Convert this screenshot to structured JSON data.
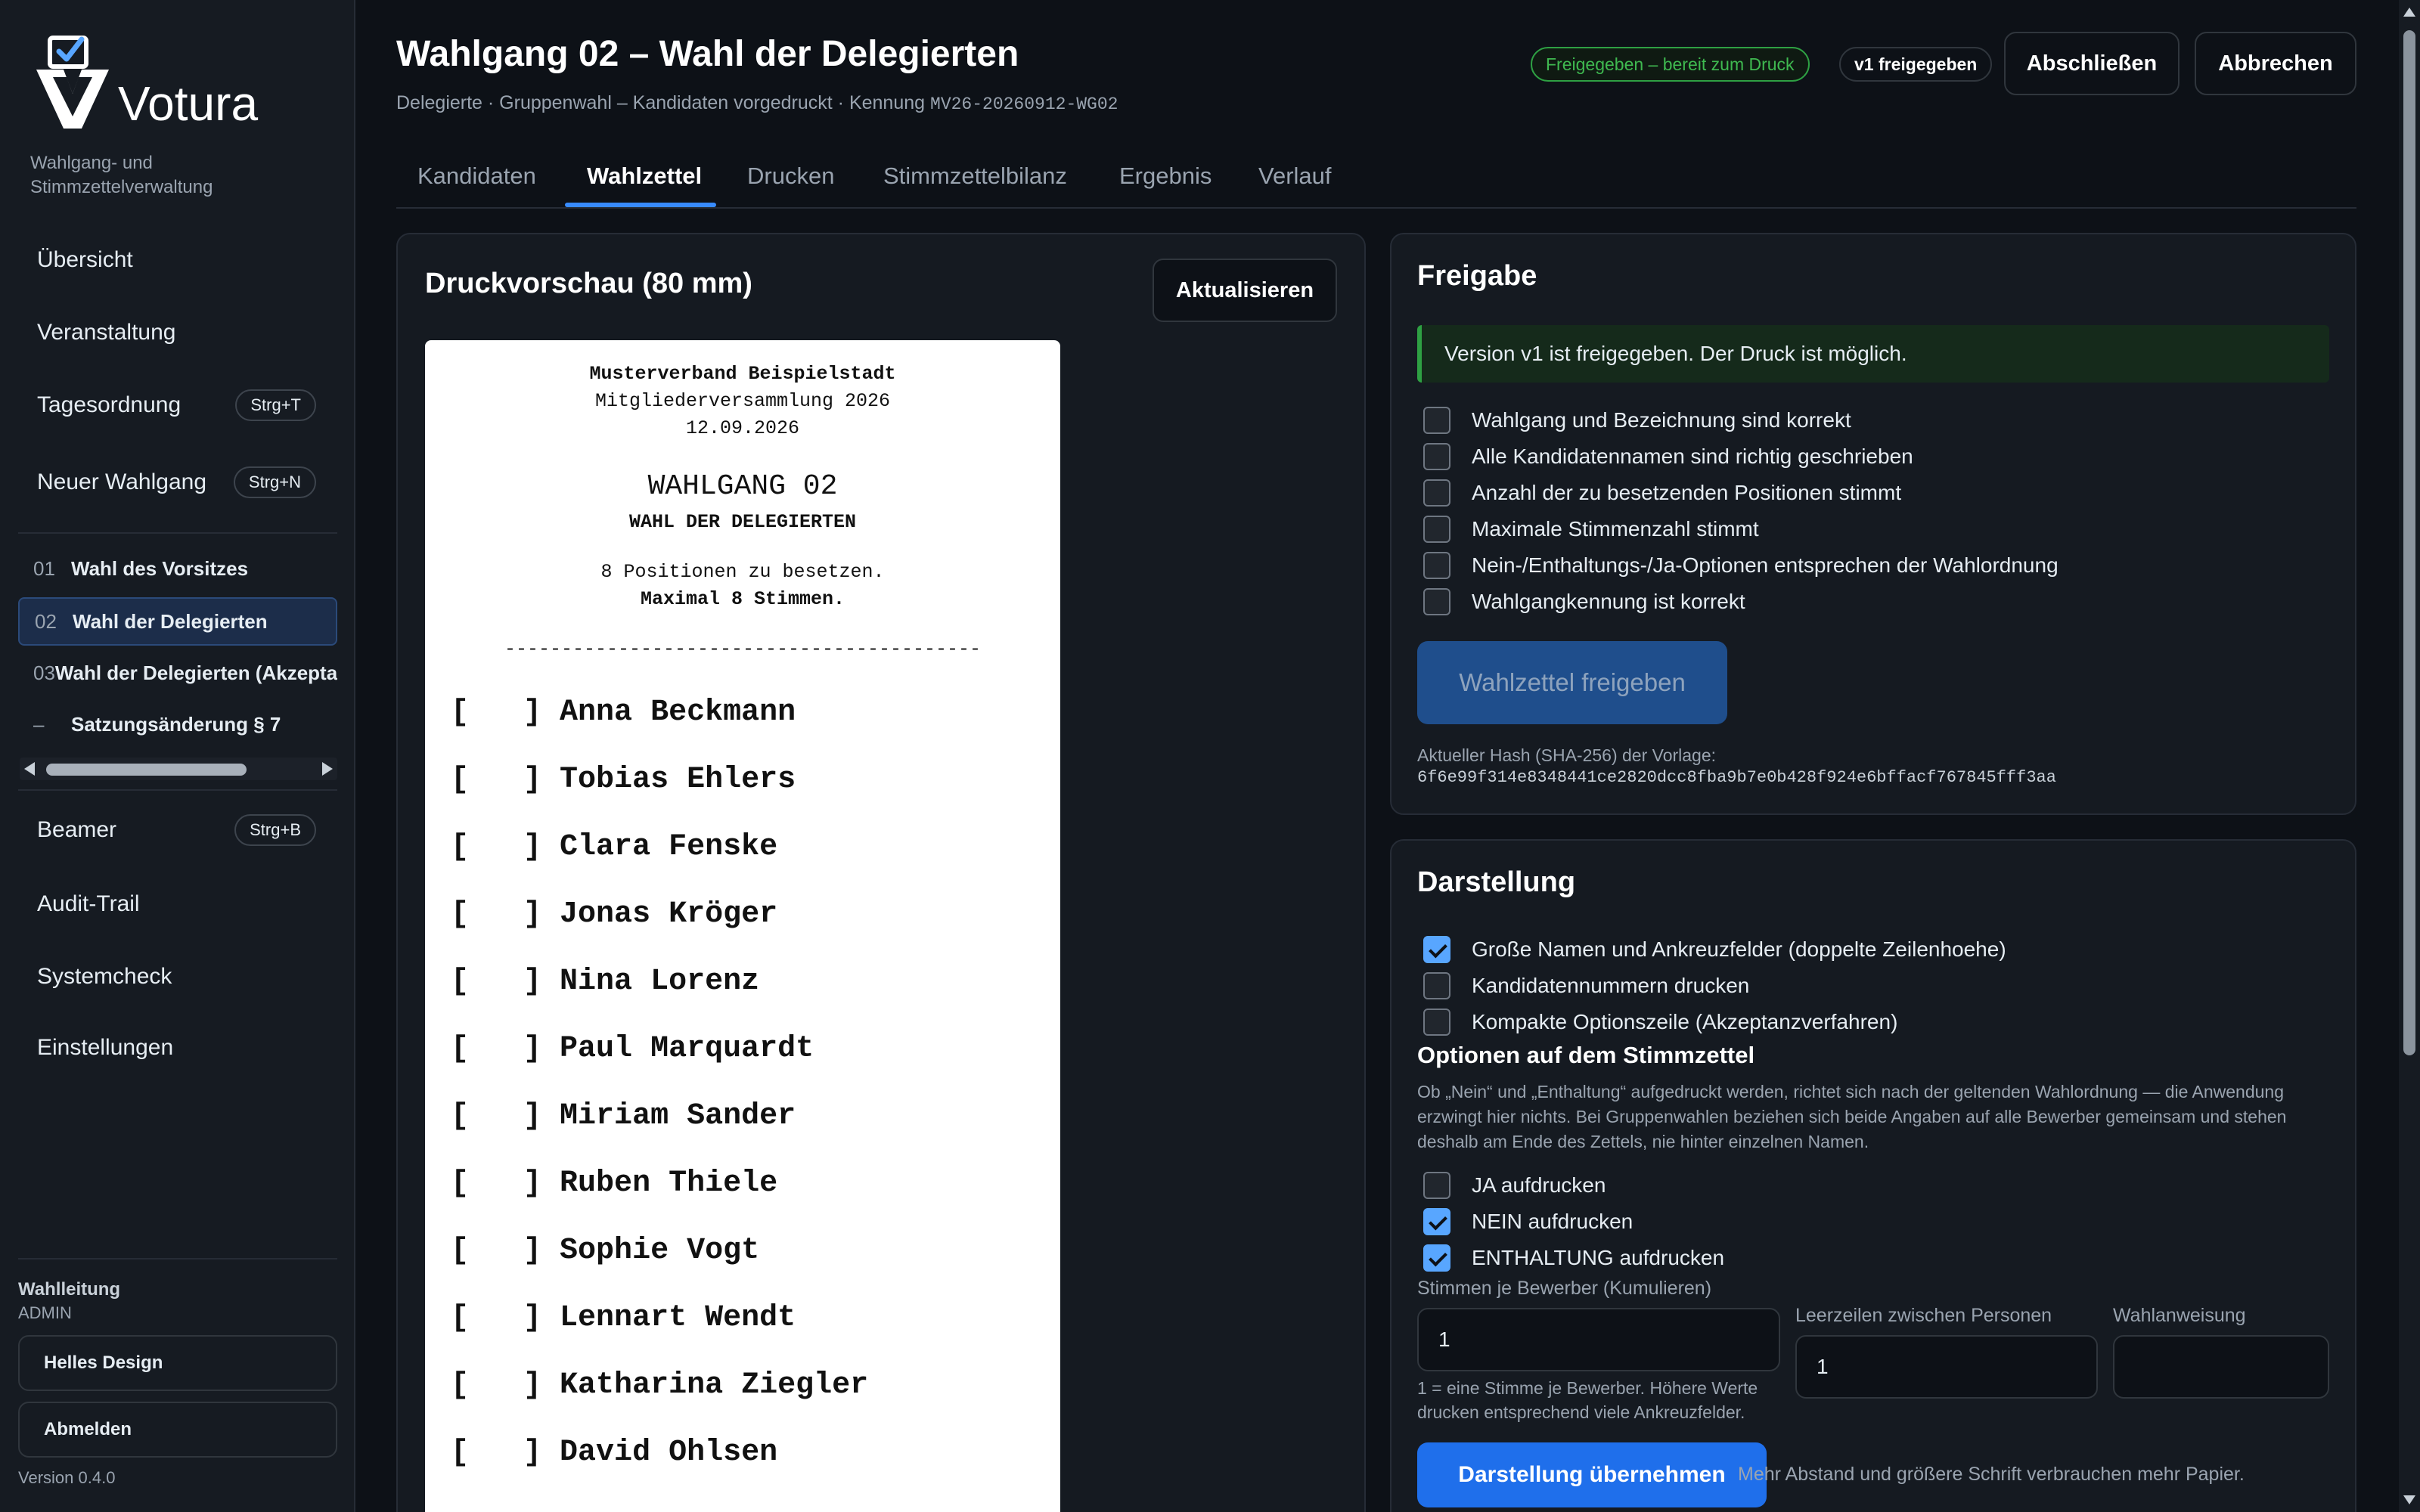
{
  "app": {
    "name": "Votura",
    "tagline": "Wahlgang- und Stimmzettelverwaltung",
    "version": "Version 0.4.0"
  },
  "sidebar": {
    "nav_top": [
      {
        "label": "Übersicht",
        "shortcut": ""
      },
      {
        "label": "Veranstaltung",
        "shortcut": ""
      },
      {
        "label": "Tagesordnung",
        "shortcut": "Strg+T"
      },
      {
        "label": "Neuer Wahlgang",
        "shortcut": "Strg+N"
      }
    ],
    "ballots": [
      {
        "num": "01",
        "label": "Wahl des Vorsitzes"
      },
      {
        "num": "02",
        "label": "Wahl der Delegierten"
      },
      {
        "num": "03",
        "label": "Wahl der Delegierten (Akzeptanzverfahren)"
      },
      {
        "num": "–",
        "label": "Satzungsänderung § 7"
      }
    ],
    "nav_bottom": [
      {
        "label": "Beamer",
        "shortcut": "Strg+B"
      },
      {
        "label": "Audit-Trail",
        "shortcut": ""
      },
      {
        "label": "Systemcheck",
        "shortcut": ""
      },
      {
        "label": "Einstellungen",
        "shortcut": ""
      }
    ],
    "role_title": "Wahlleitung",
    "role_user": "ADMIN",
    "theme_button": "Helles Design",
    "logout_button": "Abmelden"
  },
  "header": {
    "title": "Wahlgang 02 – Wahl der Delegierten",
    "subtitle": "Delegierte · Gruppenwahl – Kandidaten vorgedruckt · Kennung",
    "code": "MV26-20260912-WG02",
    "status_badge": "Freigegeben – bereit zum Druck",
    "version_badge": "v1 freigegeben",
    "close_button": "Abschließen",
    "cancel_button": "Abbrechen"
  },
  "tabs": [
    "Kandidaten",
    "Wahlzettel",
    "Drucken",
    "Stimmzettelbilanz",
    "Ergebnis",
    "Verlauf"
  ],
  "preview": {
    "title": "Druckvorschau (80 mm)",
    "refresh_button": "Aktualisieren",
    "org": "Musterverband Beispielstadt",
    "event": "Mitgliederversammlung 2026",
    "date": "12.09.2026",
    "ballot_no": "WAHLGANG 02",
    "ballot_name": "WAHL DER DELEGIERTEN",
    "positions": "8 Positionen zu besetzen.",
    "max_votes": "Maximal 8 Stimmen.",
    "separator": "------------------------------------------",
    "checkbox": "[   ]",
    "candidates": [
      "Anna Beckmann",
      "Tobias Ehlers",
      "Clara Fenske",
      "Jonas Kröger",
      "Nina Lorenz",
      "Paul Marquardt",
      "Miriam Sander",
      "Ruben Thiele",
      "Sophie Vogt",
      "Lennart Wendt",
      "Katharina Ziegler",
      "David Ohlsen"
    ]
  },
  "release": {
    "title": "Freigabe",
    "alert": "Version v1 ist freigegeben. Der Druck ist möglich.",
    "checks": [
      {
        "label": "Wahlgang und Bezeichnung sind korrekt",
        "checked": false
      },
      {
        "label": "Alle Kandidatennamen sind richtig geschrieben",
        "checked": false
      },
      {
        "label": "Anzahl der zu besetzenden Positionen stimmt",
        "checked": false
      },
      {
        "label": "Maximale Stimmenzahl stimmt",
        "checked": false
      },
      {
        "label": "Nein-/Enthaltungs-/Ja-Optionen entsprechen der Wahlordnung",
        "checked": false
      },
      {
        "label": "Wahlgangkennung ist korrekt",
        "checked": false
      }
    ],
    "release_button": "Wahlzettel freigeben",
    "hash_label": "Aktueller Hash (SHA-256) der Vorlage:",
    "hash_value": "6f6e99f314e8348441ce2820dcc8fba9b7e0b428f924e6bffacf767845fff3aa"
  },
  "display": {
    "title": "Darstellung",
    "options": [
      {
        "label": "Große Namen und Ankreuzfelder (doppelte Zeilenhoehe)",
        "checked": true
      },
      {
        "label": "Kandidatennummern drucken",
        "checked": false
      },
      {
        "label": "Kompakte Optionszeile (Akzeptanzverfahren)",
        "checked": false
      }
    ],
    "ballot_options_title": "Optionen auf dem Stimmzettel",
    "ballot_options_note": "Ob „Nein“ und „Enthaltung“ aufgedruckt werden, richtet sich nach der geltenden Wahlordnung — die Anwendung erzwingt hier nichts. Bei Gruppenwahlen beziehen sich beide Angaben auf alle Bewerber gemeinsam und stehen deshalb am Ende des Zettels, nie hinter einzelnen Namen.",
    "ballot_options": [
      {
        "label": "JA aufdrucken",
        "checked": false
      },
      {
        "label": "NEIN aufdrucken",
        "checked": true
      },
      {
        "label": "ENTHALTUNG aufdrucken",
        "checked": true
      }
    ],
    "votes_label": "Stimmen je Bewerber (Kumulieren)",
    "votes_value": "1",
    "votes_hint": "1 = eine Stimme je Bewerber. Höhere Werte drucken entsprechend viele Ankreuzfelder.",
    "blank_lines_label": "Leerzeilen zwischen Personen",
    "blank_lines_value": "1",
    "instruction_label": "Wahlanweisung",
    "instruction_value": "",
    "apply_button": "Darstellung übernehmen",
    "apply_tip": "Mehr Abstand und größere Schrift verbrauchen mehr Papier."
  }
}
